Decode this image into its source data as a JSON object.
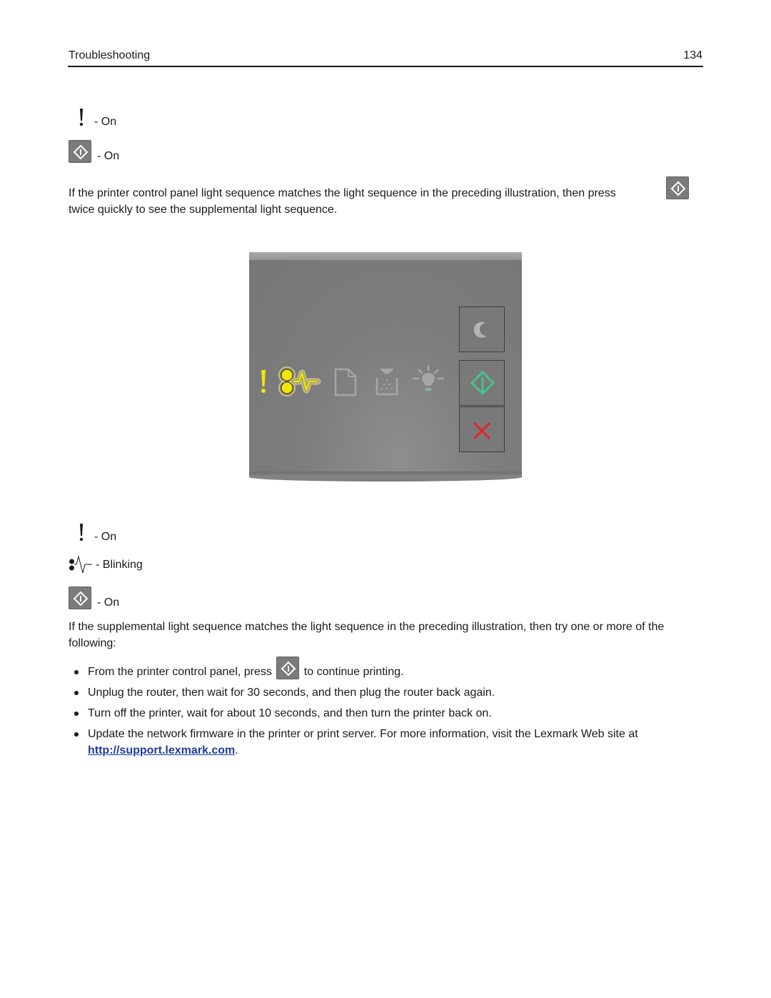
{
  "header": {
    "section_title": "Troubleshooting",
    "page_number": "134"
  },
  "first_sequence": {
    "items": [
      {
        "icon": "error-exclamation-icon",
        "state": "- On"
      },
      {
        "icon": "start-button-icon",
        "state": "- On"
      }
    ]
  },
  "instruction_1": {
    "before_icon": "If the printer control panel light sequence matches the light sequence in the preceding illustration, then press",
    "after_icon": "twice quickly to see the supplemental light sequence."
  },
  "control_panel": {
    "lights": [
      {
        "name": "error-light",
        "icon": "exclamation",
        "state": "on",
        "color": "#f2e600"
      },
      {
        "name": "paper-jam-light",
        "icon": "paper-jam",
        "state": "blinking",
        "color": "#f2e600"
      },
      {
        "name": "load-paper-light",
        "icon": "paper",
        "state": "off",
        "color": "#a6a6a6"
      },
      {
        "name": "toner-light",
        "icon": "toner",
        "state": "off",
        "color": "#a6a6a6"
      },
      {
        "name": "ready-light",
        "icon": "lightbulb",
        "state": "off",
        "color": "#a6a6a6"
      }
    ],
    "buttons": [
      {
        "name": "sleep-button",
        "icon": "moon",
        "color": "#b4b4b4"
      },
      {
        "name": "start-button",
        "icon": "start-diamond",
        "color": "#45c48d"
      },
      {
        "name": "stop-button",
        "icon": "x-cancel",
        "color": "#e8202a"
      }
    ]
  },
  "supplemental_sequence": {
    "items": [
      {
        "icon": "error-exclamation-icon",
        "state": "- On"
      },
      {
        "icon": "paper-jam-icon",
        "state": "- Blinking"
      },
      {
        "icon": "start-button-icon",
        "state": "- On"
      }
    ]
  },
  "instruction_2": "If the supplemental light sequence matches the light sequence in the preceding illustration, then try one or more of the following:",
  "bullets": {
    "b1_before": "From the printer control panel, press",
    "b1_after": "to continue printing.",
    "b2": "Unplug the router, then wait for 30 seconds, and then plug the router back again.",
    "b3": "Turn off the printer, wait for about 10 seconds, and then turn the printer back on.",
    "b4_text": "Update the network firmware in the printer or print server. For more information, visit the Lexmark Web site at",
    "b4_link": "http://support.lexmark.com",
    "b4_end": "."
  }
}
